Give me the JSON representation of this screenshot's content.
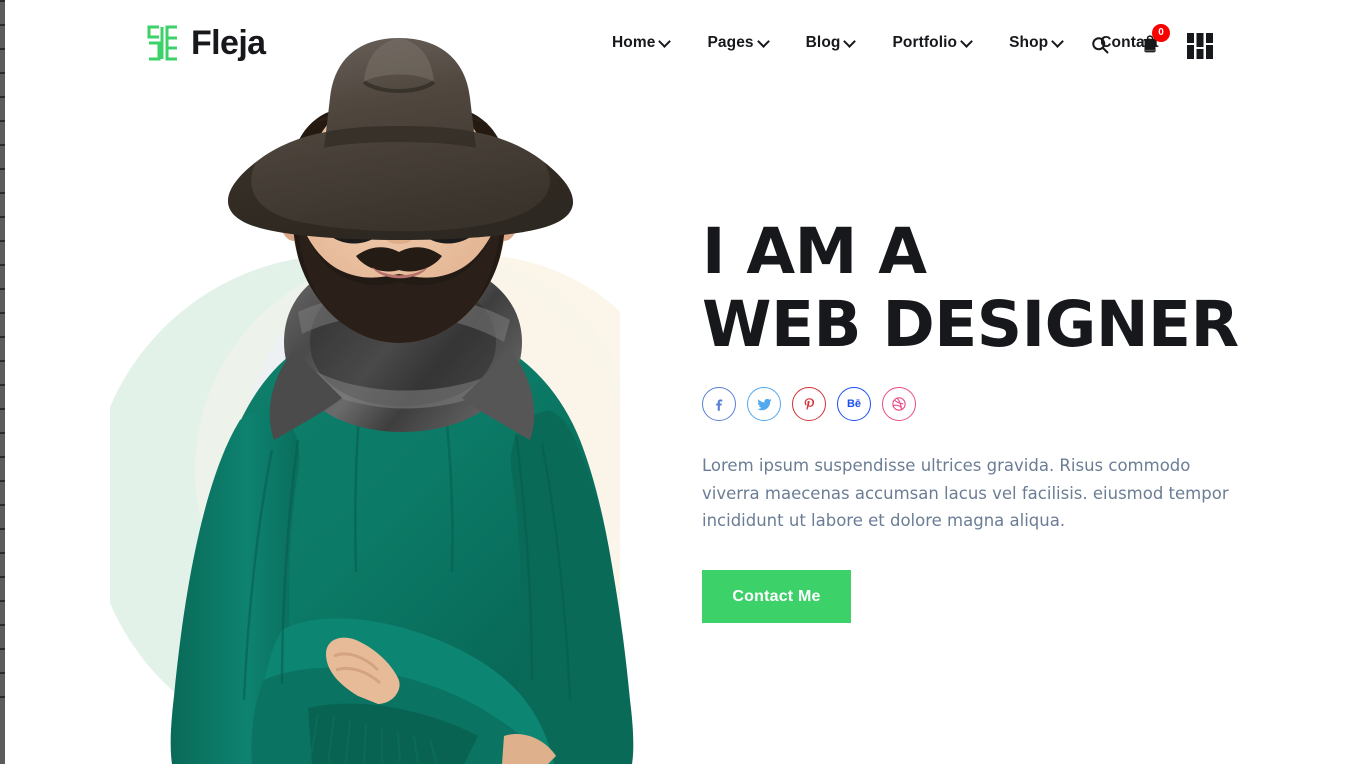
{
  "brand": {
    "name": "Fleja",
    "logo_icon": "fleja-bracket-logo",
    "logo_color": "#3dd16a"
  },
  "nav": {
    "items": [
      {
        "label": "Home",
        "has_dropdown": true
      },
      {
        "label": "Pages",
        "has_dropdown": true
      },
      {
        "label": "Blog",
        "has_dropdown": true
      },
      {
        "label": "Portfolio",
        "has_dropdown": true
      },
      {
        "label": "Shop",
        "has_dropdown": true
      },
      {
        "label": "Contact",
        "has_dropdown": false
      }
    ]
  },
  "header_tools": {
    "search_icon": "search-icon",
    "cart_icon": "shopping-bag-icon",
    "cart_count": "0",
    "cart_badge_color": "#fa0000",
    "menu_icon": "grid-menu-icon"
  },
  "hero": {
    "headline_line1": "I AM A",
    "headline_line2": "WEB DESIGNER",
    "paragraph": "Lorem ipsum suspendisse ultrices gravida. Risus commodo viverra maecenas accumsan lacus vel facilisis. eiusmod tempor incididunt ut labore et dolore magna aliqua.",
    "cta_label": "Contact Me",
    "cta_color": "#3dd16a",
    "heading_color": "#16181c",
    "paragraph_color": "#6b7d95",
    "socials": [
      {
        "name": "facebook",
        "glyph": "f",
        "color": "#5a7fd6"
      },
      {
        "name": "twitter",
        "glyph": "t",
        "color": "#53a9ef"
      },
      {
        "name": "pinterest",
        "glyph": "p",
        "color": "#d1333a"
      },
      {
        "name": "behance",
        "glyph": "Bē",
        "color": "#1d4ff0"
      },
      {
        "name": "dribbble",
        "glyph": "d",
        "color": "#ea4c89"
      }
    ],
    "portrait_alt": "Bearded man with hat, glasses and green sweater, arms crossed",
    "blob_colors": [
      "#e1f2e8",
      "#e7f0ea",
      "#faf4e4",
      "#eef0f7"
    ]
  }
}
